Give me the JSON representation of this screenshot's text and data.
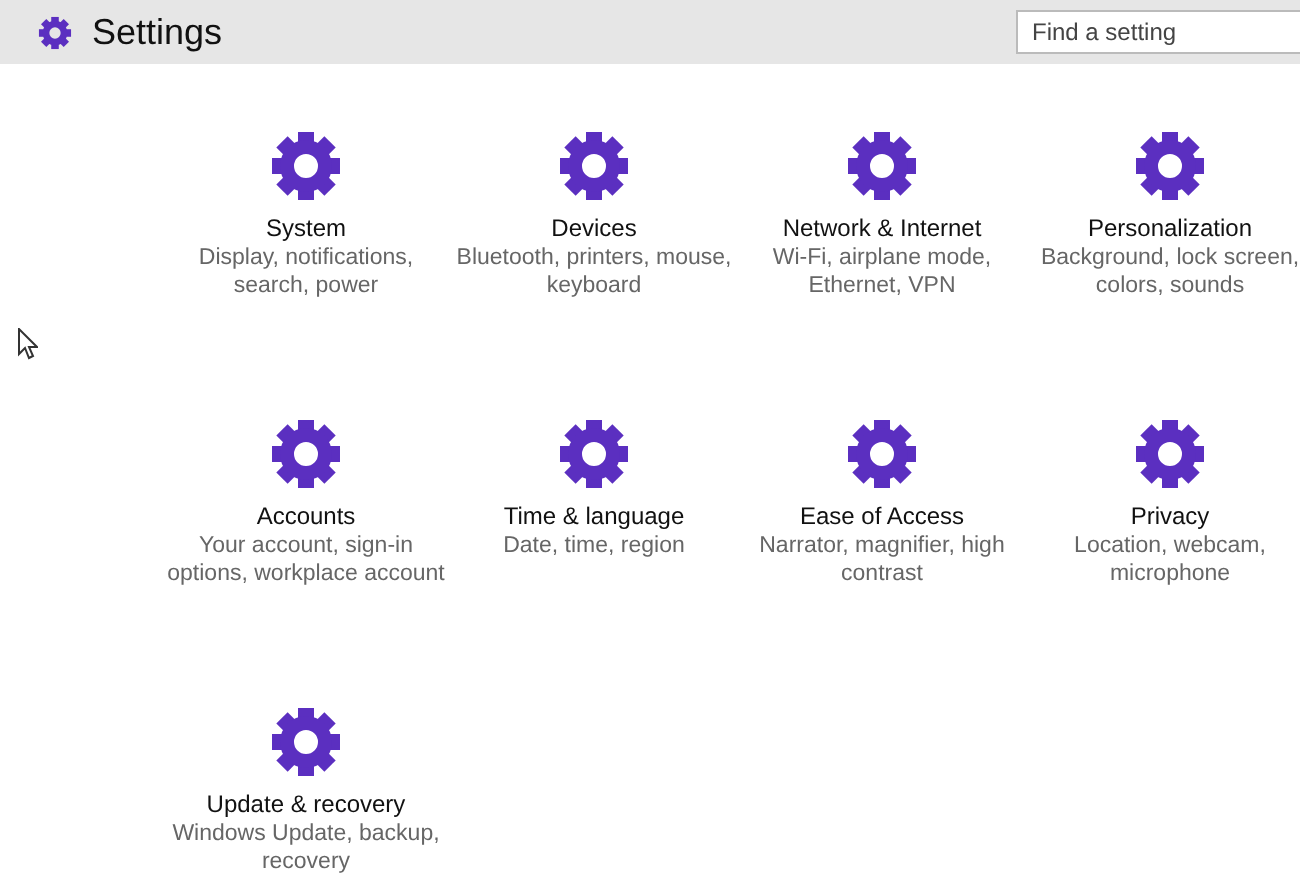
{
  "window": {
    "title": "Settings"
  },
  "search": {
    "placeholder": "Find a setting"
  },
  "categories": [
    {
      "title": "System",
      "description": "Display, notifications, search, power"
    },
    {
      "title": "Devices",
      "description": "Bluetooth, printers, mouse, keyboard"
    },
    {
      "title": "Network & Internet",
      "description": "Wi-Fi, airplane mode, Ethernet, VPN"
    },
    {
      "title": "Personalization",
      "description": "Background, lock screen, colors, sounds"
    },
    {
      "title": "Accounts",
      "description": "Your account, sign-in options, workplace account"
    },
    {
      "title": "Time & language",
      "description": "Date, time, region"
    },
    {
      "title": "Ease of Access",
      "description": "Narrator, magnifier, high contrast"
    },
    {
      "title": "Privacy",
      "description": "Location, webcam, microphone"
    },
    {
      "title": "Update & recovery",
      "description": "Windows Update, backup, recovery"
    }
  ]
}
